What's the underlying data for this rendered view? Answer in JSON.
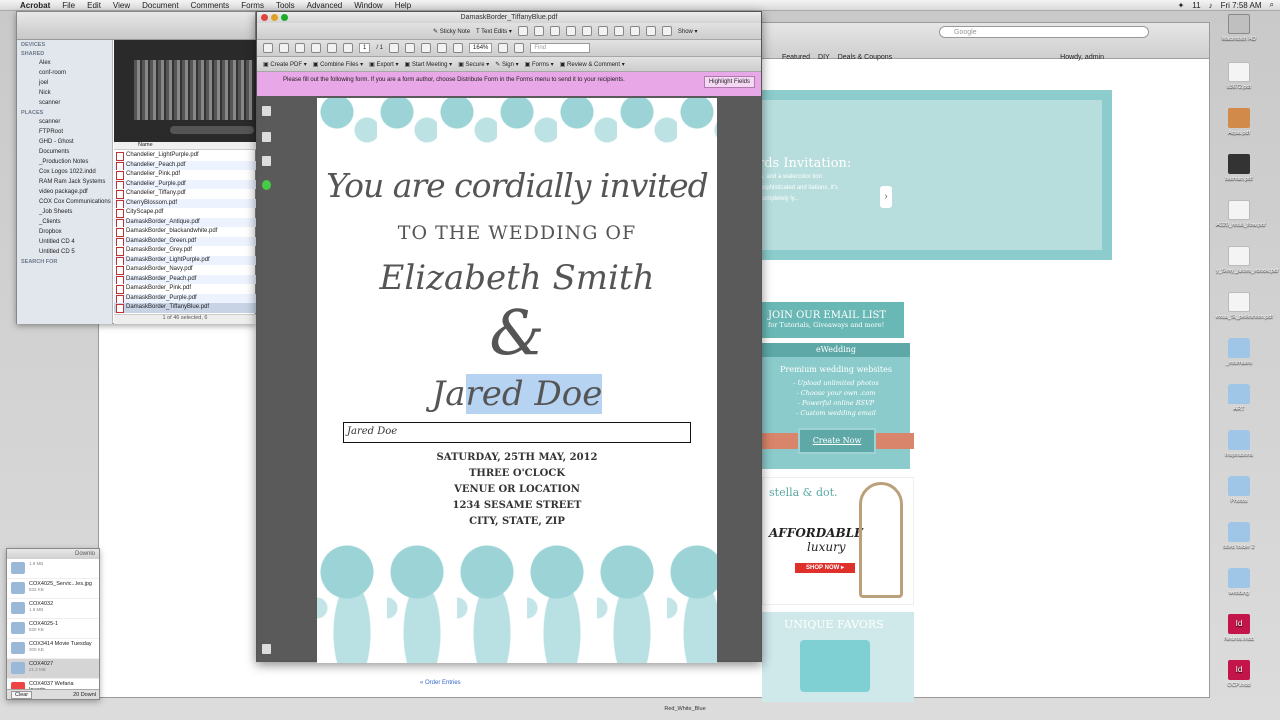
{
  "menubar": {
    "app": "Acrobat",
    "items": [
      "File",
      "Edit",
      "View",
      "Document",
      "Comments",
      "Forms",
      "Tools",
      "Advanced",
      "Window",
      "Help"
    ],
    "clock": "Fri 7:58 AM",
    "wifi": "11"
  },
  "browser": {
    "search_placeholder": "Google",
    "nav": [
      "Featured",
      "DIY",
      "Deals & Coupons"
    ],
    "howdy": "Howdy, admin",
    "banner_title": "rds Invitation:",
    "banner_text": "s, and a watercolor tion sophisticated and itations, it's completely ly...",
    "email_title": "JOIN OUR EMAIL LIST",
    "email_sub": "for Tutorials, Giveaways and more!",
    "ewedding_head": "eWedding",
    "ewedding_premium": "Premium wedding websites",
    "ewedding_items": [
      "- Upload unlimited photos",
      "- Choose your own .com",
      "- Powerful online RSVP",
      "- Custom wedding email"
    ],
    "create_now": "Create Now",
    "stella_brand": "stella & dot.",
    "affordable": "AFFORDABLE",
    "luxury": "luxury",
    "shop_now": "SHOP NOW ▸",
    "unique_favors": "UNIQUE FAVORS",
    "order_entries": "« Order Entries"
  },
  "finder": {
    "sections": {
      "devices": "DEVICES",
      "shared": "SHARED",
      "places": "PLACES",
      "search": "SEARCH FOR"
    },
    "shared_items": [
      "Alex",
      "conf-room",
      "joel",
      "Nick",
      "scanner"
    ],
    "places_items": [
      "scanner",
      "FTPRoot",
      "GHD - Ghost",
      "Documents",
      "_Production Notes",
      "Cox Logos 1022.indd",
      "RAM Ram Jack Systems",
      "video package.pdf",
      "COX Cox Communications",
      "_Job Sheets",
      "_Clients",
      "Dropbox",
      "Untitled CD 4",
      "Untitled CD 5"
    ],
    "column_header": "Name",
    "files": [
      "Chandelier_LightPurple.pdf",
      "Chandelier_Peach.pdf",
      "Chandelier_Pink.pdf",
      "Chandelier_Purple.pdf",
      "Chandelier_Tiffany.pdf",
      "CherryBlossom.pdf",
      "CityScape.pdf",
      "DamaskBorder_Antique.pdf",
      "DamaskBorder_blackandwhite.pdf",
      "DamaskBorder_Green.pdf",
      "DamaskBorder_Grey.pdf",
      "DamaskBorder_LightPurple.pdf",
      "DamaskBorder_Navy.pdf",
      "DamaskBorder_Peach.pdf",
      "DamaskBorder_Pink.pdf",
      "DamaskBorder_Purple.pdf",
      "DamaskBorder_TiffanyBlue.pdf"
    ],
    "selected_file": "DamaskBorder_TiffanyBlue.pdf",
    "status": "1 of 46 selected, 6"
  },
  "downloads": {
    "title": "Downlo",
    "items": [
      {
        "name": "",
        "size": "1.8 MB"
      },
      {
        "name": "COX4025_Servic...les.jpg",
        "size": "832 KB"
      },
      {
        "name": "COX4032",
        "size": "1.9 MB"
      },
      {
        "name": "COX4025-1",
        "size": "830 KB"
      },
      {
        "name": "COX3414 Movie Tuesday",
        "size": "300 KB"
      },
      {
        "name": "COX4027",
        "size": "21.2 MB"
      },
      {
        "name": "COX4037 Wefaria Inverts_...",
        "size": "376 KB"
      }
    ],
    "clear": "Clear",
    "count": "20 Downl"
  },
  "acrobat": {
    "title": "DamaskBorder_TiffanyBlue.pdf",
    "sticky": "Sticky Note",
    "text_edits": "Text Edits",
    "show": "Show",
    "page_current": "1",
    "page_total": "/ 1",
    "zoom": "164%",
    "find": "Find",
    "create_pdf": "Create PDF",
    "combine": "Combine Files",
    "export": "Export",
    "start_meeting": "Start Meeting",
    "secure": "Secure",
    "sign": "Sign",
    "forms": "Forms",
    "review": "Review & Comment",
    "form_message": "Please fill out the following form. If you are a form author, choose Distribute Form in the Forms menu to send it to your recipients.",
    "highlight_fields": "Highlight Fields"
  },
  "pdf": {
    "invite": "You are cordially invited",
    "to_wedding": "TO THE WEDDING OF",
    "bride": "Elizabeth Smith",
    "ampersand": "&",
    "groom_a": "Ja",
    "groom_b": "red Doe",
    "field_value": "Jared Doe",
    "date": "SATURDAY, 25TH MAY, 2012",
    "time": "THREE O'CLOCK",
    "venue": "VENUE OR LOCATION",
    "street": "1234 SESAME STREET",
    "city": "CITY, STATE, ZIP"
  },
  "desktop": {
    "icons": [
      "Macintosh HD",
      "s3672.pdf",
      "Aqua.pdf",
      "batman.pdf",
      "A020_retail_flow.pdf",
      "y_Sexy_juices_ebook.pdf",
      "exua_Si_pelleshion.pdf",
      "_estimates",
      "ART",
      "Inspirations",
      "Photos",
      "titled folder 2",
      "wedding",
      "Neuros.indd",
      "OCP.indd"
    ],
    "bottom_labels": [
      "Red_White_Blue"
    ]
  }
}
